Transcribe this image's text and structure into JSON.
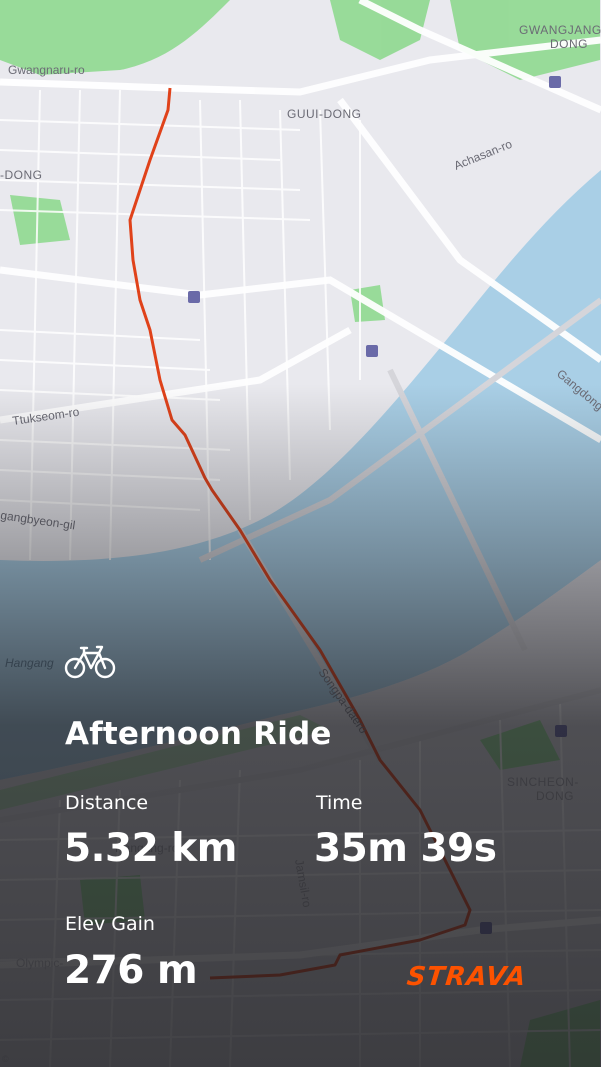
{
  "activity": {
    "sport_icon": "bicycle-icon",
    "title": "Afternoon Ride",
    "stats": {
      "distance_label": "Distance",
      "distance_value": "5.32 km",
      "time_label": "Time",
      "time_value": "35m 39s",
      "elev_label": "Elev Gain",
      "elev_value": "276 m"
    }
  },
  "brand": {
    "logo_text": "STRAVA",
    "color": "#fc5200"
  },
  "map": {
    "route_color": "#e0421a",
    "water_color": "#aed3ea",
    "park_color": "#8fd98f",
    "labels": {
      "gwangjang": "GWANGJANG",
      "dong1": "DONG",
      "gwangnaru": "Gwangnaru-ro",
      "guui": "GUUI-DONG",
      "dong2": "-DONG",
      "achasan": "Achasan-ro",
      "gangdong": "Gangdong-d",
      "ttukseom": "Ttukseom-ro",
      "gangbyeon": "gangbyeon-gil",
      "hangang1": "Hangang",
      "hangang2": "Hangang-ro",
      "songpa": "Songpa-daero",
      "sincheon1": "SINCHEON-",
      "sincheon2": "DONG",
      "jamsil": "Jamsil-ro",
      "olympic": "Olympic-",
      "copyright": "©"
    }
  }
}
